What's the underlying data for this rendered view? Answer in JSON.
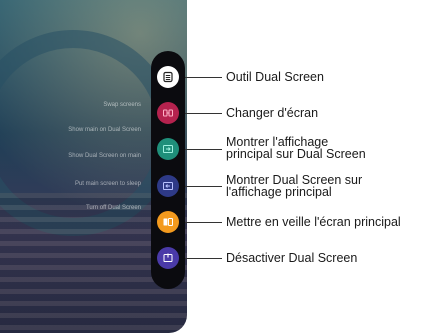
{
  "menu_items": [
    {
      "label": "Outil Dual Screen",
      "icon": "dual-screen-tool-icon",
      "color": "#ffffff"
    },
    {
      "label": "Changer d'écran",
      "icon": "swap-screen-icon",
      "color": "#b5224e"
    },
    {
      "label": "Montrer l'affichage principal sur Dual Screen",
      "label_lines": [
        "Montrer l'affichage",
        "principal sur Dual Screen"
      ],
      "icon": "main-to-dual-icon",
      "color": "#1f8f7a"
    },
    {
      "label": "Montrer Dual Screen sur l'affichage principal",
      "label_lines": [
        "Montrer Dual Screen sur",
        "l'affichage principal"
      ],
      "icon": "dual-to-main-icon",
      "color": "#2e3a87"
    },
    {
      "label": "Mettre en veille l'écran principal",
      "icon": "sleep-main-screen-icon",
      "color": "#f39a1e"
    },
    {
      "label": "Désactiver Dual Screen",
      "icon": "disable-dual-screen-icon",
      "color": "#4a3aa8"
    }
  ]
}
